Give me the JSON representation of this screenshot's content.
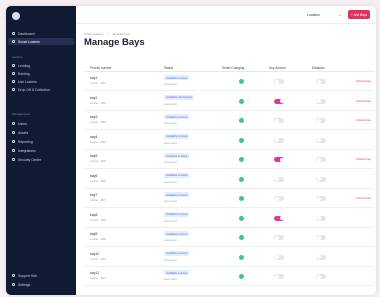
{
  "app": {
    "logo_text": "Dashboard"
  },
  "sidebar": {
    "top_items": [
      {
        "label": "Dashboard"
      },
      {
        "label": "Smart Lockers"
      }
    ],
    "section_locker": "Lockers",
    "locker_items": [
      {
        "label": "Lending"
      },
      {
        "label": "Renting"
      },
      {
        "label": "Use Lockers"
      },
      {
        "label": "Drop Off & Collection"
      }
    ],
    "section_management": "Management",
    "management_items": [
      {
        "label": "Users"
      },
      {
        "label": "Assets"
      },
      {
        "label": "Reporting"
      },
      {
        "label": "Integrations"
      },
      {
        "label": "Security Centre"
      }
    ],
    "bottom_items": [
      {
        "label": "Support Hub"
      },
      {
        "label": "Settings"
      }
    ]
  },
  "topbar": {
    "location_value": "Location",
    "add_label": "+ Add Bays"
  },
  "breadcrumb": [
    "Smart Lockers",
    ">",
    "Residence 2"
  ],
  "page": {
    "title": "Manage Bays"
  },
  "table": {
    "headers": [
      "Priority number",
      "Status",
      "Smart Charging",
      "Key Access",
      "Disabled"
    ],
    "unbook_label": "Unbook bay",
    "rows": [
      {
        "name": "bay1",
        "sub": "Locker - B01",
        "status": "Available to book",
        "status_sub": "Last event",
        "key": false,
        "unbook": true
      },
      {
        "name": "bay2",
        "sub": "Locker - B02",
        "status": "Available (Occupied)",
        "status_sub": "Last event",
        "key": true,
        "unbook": true
      },
      {
        "name": "bay3",
        "sub": "Locker - B03",
        "status": "Available to book",
        "status_sub": "Last event",
        "key": false,
        "unbook": true
      },
      {
        "name": "bay4",
        "sub": "Locker - B04",
        "status": "Available to book",
        "status_sub": "Last event",
        "key": false,
        "unbook": false
      },
      {
        "name": "bay5",
        "sub": "Locker - B05",
        "status": "Available to book",
        "status_sub": "Last event",
        "key": true,
        "unbook": true
      },
      {
        "name": "bay6",
        "sub": "Locker - B06",
        "status": "Available to book",
        "status_sub": "Last event",
        "key": false,
        "unbook": false
      },
      {
        "name": "bay7",
        "sub": "Locker - B07",
        "status": "Available to book",
        "status_sub": "Last event",
        "key": false,
        "unbook": true
      },
      {
        "name": "bay8",
        "sub": "Locker - B08",
        "status": "Available to book",
        "status_sub": "Last event",
        "key": true,
        "unbook": false
      },
      {
        "name": "bay9",
        "sub": "Locker - B09",
        "status": "Available to book",
        "status_sub": "Last event",
        "key": false,
        "unbook": false
      },
      {
        "name": "bay10",
        "sub": "Locker - B10",
        "status": "Available to book",
        "status_sub": "Last event",
        "key": false,
        "unbook": false
      },
      {
        "name": "bay11",
        "sub": "Locker - B11",
        "status": "Available to book",
        "status_sub": "Last event",
        "key": false,
        "unbook": false
      }
    ]
  },
  "colors": {
    "accent": "#e0325e",
    "sidebar": "#101a33",
    "toggle_on": "#d43fa0",
    "check": "#3fc2a2"
  }
}
